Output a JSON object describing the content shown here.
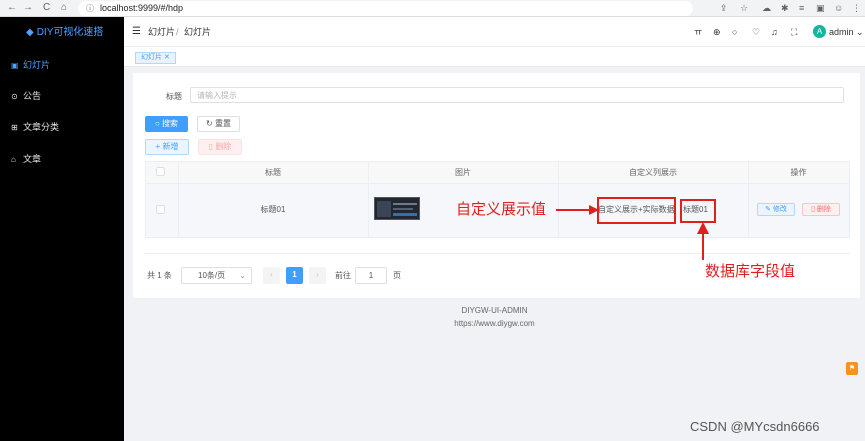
{
  "browser": {
    "url": "localhost:9999/#/hdp",
    "back": "←",
    "forward": "→",
    "reload": "C",
    "home": "⌂"
  },
  "sidebar": {
    "logo": "DIY可视化速搭",
    "items": [
      {
        "label": "幻灯片",
        "icon": "image-icon"
      },
      {
        "label": "公告",
        "icon": "notice-icon"
      },
      {
        "label": "文章分类",
        "icon": "category-icon"
      },
      {
        "label": "文章",
        "icon": "home-icon"
      }
    ]
  },
  "header": {
    "breadcrumb": [
      "幻灯片",
      "幻灯片"
    ],
    "breadcrumb_sep": "/",
    "avatar_letter": "A",
    "user": "admin"
  },
  "tags": {
    "active": "幻灯片"
  },
  "search": {
    "title_label": "标题",
    "title_placeholder": "请输入提示",
    "search_label": "搜索",
    "reset_label": "重置",
    "add_label": "新增",
    "delete_label": "删除"
  },
  "table": {
    "columns": [
      "标题",
      "图片",
      "自定义列展示",
      "操作"
    ],
    "rows": [
      {
        "title": "标题01",
        "custom_prefix": "自定义展示+实际数据",
        "custom_value": "标题01",
        "edit_label": "修改",
        "delete_label": "删除"
      }
    ]
  },
  "annotations": {
    "custom_value_label": "自定义展示值",
    "db_value_label": "数据库字段值"
  },
  "pagination": {
    "total_text": "共 1 条",
    "page_size": "10条/页",
    "current_page": "1",
    "goto_label": "前往",
    "goto_value": "1",
    "page_unit": "页"
  },
  "footer": {
    "brand": "DIYGW-UI-ADMIN",
    "url": "https://www.diygw.com"
  },
  "watermark": "CSDN @MYcsdn6666",
  "colors": {
    "primary": "#409eff",
    "sidebar_bg": "#000000",
    "annotation": "#e02020"
  }
}
